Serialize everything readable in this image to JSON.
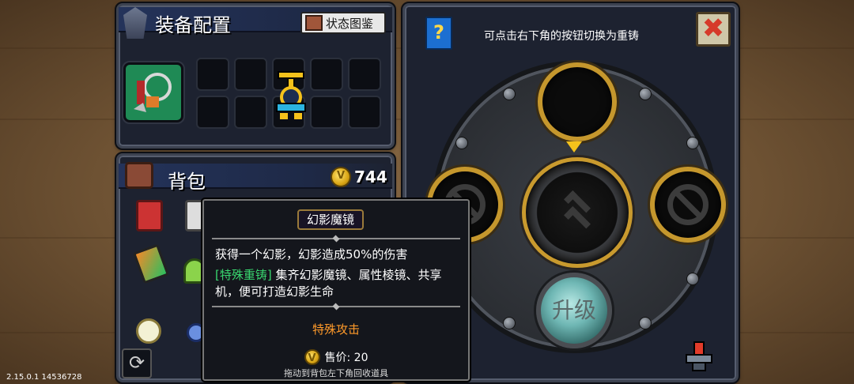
{
  "equipment": {
    "title": "装备配置",
    "codex_button": "状态图鉴"
  },
  "backpack": {
    "title": "背包",
    "coins": "744"
  },
  "tooltip": {
    "item_name": "幻影魔镜",
    "description": "获得一个幻影，幻影造成50%的伤害",
    "reforge_tag": "[特殊重铸]",
    "reforge_text": " 集齐幻影魔镜、属性棱镜、共享机，便可打造幻影生命",
    "type": "特殊攻击",
    "price": "售价: 20",
    "hint": "拖动到背包左下角回收道具"
  },
  "forge": {
    "hint": "可点击右下角的按钮切换为重铸",
    "close_icon": "✖",
    "upgrade_label": "升级",
    "help_icon": "?"
  },
  "version": "2.15.0.1 14536728",
  "colors": {
    "gold": "#c5972d",
    "reforge_green": "#39d66f",
    "type_orange": "#ff9a2a",
    "weapon_slot_green": "#1f8a55"
  }
}
